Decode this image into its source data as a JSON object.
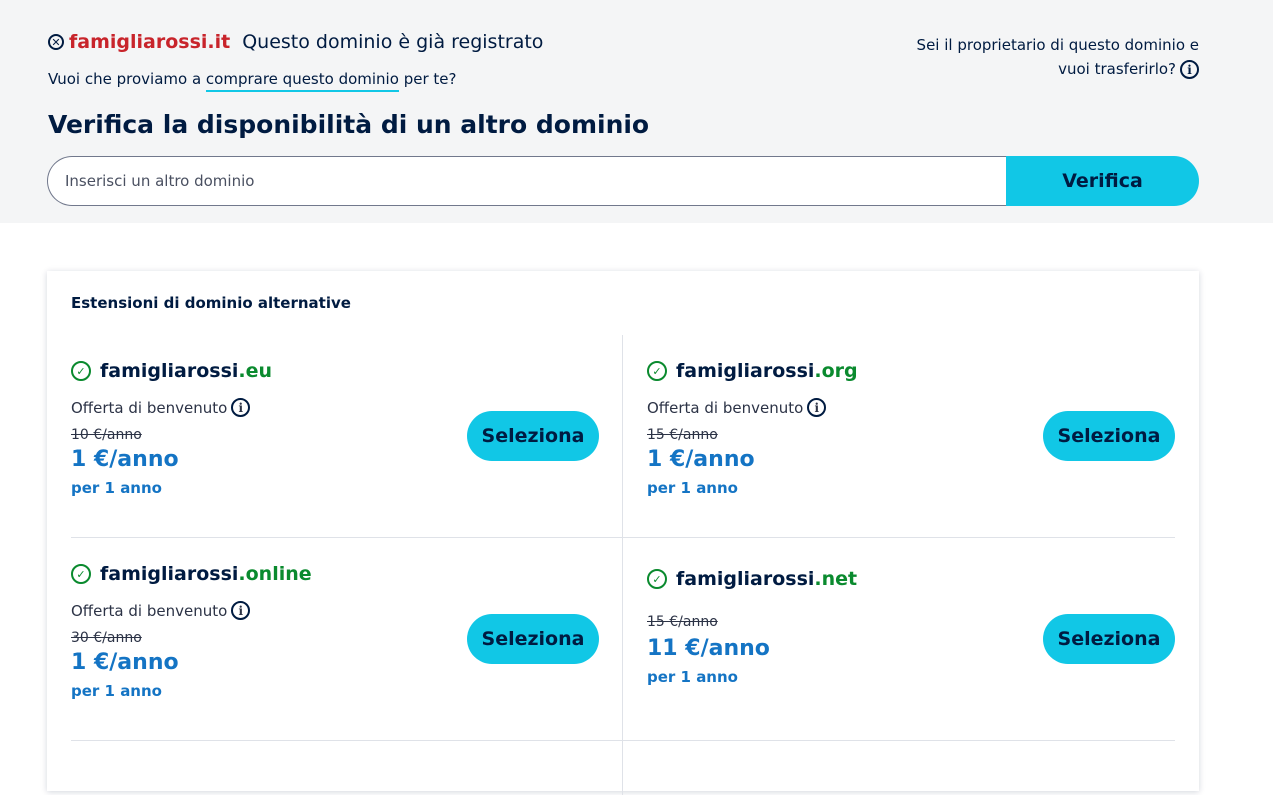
{
  "status": {
    "domain": "famigliarossi.it",
    "message": "Questo dominio è già registrato",
    "buy_prefix": "Vuoi che proviamo a",
    "buy_link": "comprare questo dominio",
    "buy_suffix": "per te?",
    "owner_line1": "Sei il proprietario di questo dominio e",
    "owner_line2": "vuoi trasferirlo?"
  },
  "search": {
    "heading": "Verifica la disponibilità di un altro dominio",
    "placeholder": "Inserisci un altro dominio",
    "button": "Verifica"
  },
  "alternatives": {
    "title": "Estensioni di dominio alternative",
    "select_label": "Seleziona",
    "items": [
      {
        "name": "famigliarossi",
        "tld": ".eu",
        "offer": "Offerta di benvenuto",
        "old_price": "10 €/anno",
        "price": "1 €/anno",
        "period": "per 1 anno"
      },
      {
        "name": "famigliarossi",
        "tld": ".org",
        "offer": "Offerta di benvenuto",
        "old_price": "15 €/anno",
        "price": "1 €/anno",
        "period": "per 1 anno"
      },
      {
        "name": "famigliarossi",
        "tld": ".online",
        "offer": "Offerta di benvenuto",
        "old_price": "30 €/anno",
        "price": "1 €/anno",
        "period": "per 1 anno"
      },
      {
        "name": "famigliarossi",
        "tld": ".net",
        "offer": "",
        "old_price": "15 €/anno",
        "price": "11 €/anno",
        "period": "per 1 anno"
      }
    ]
  },
  "colors": {
    "accent": "#11c7e6",
    "navy": "#001b41",
    "taken": "#c8242b",
    "available": "#0a8a2e",
    "price": "#1474c4"
  }
}
